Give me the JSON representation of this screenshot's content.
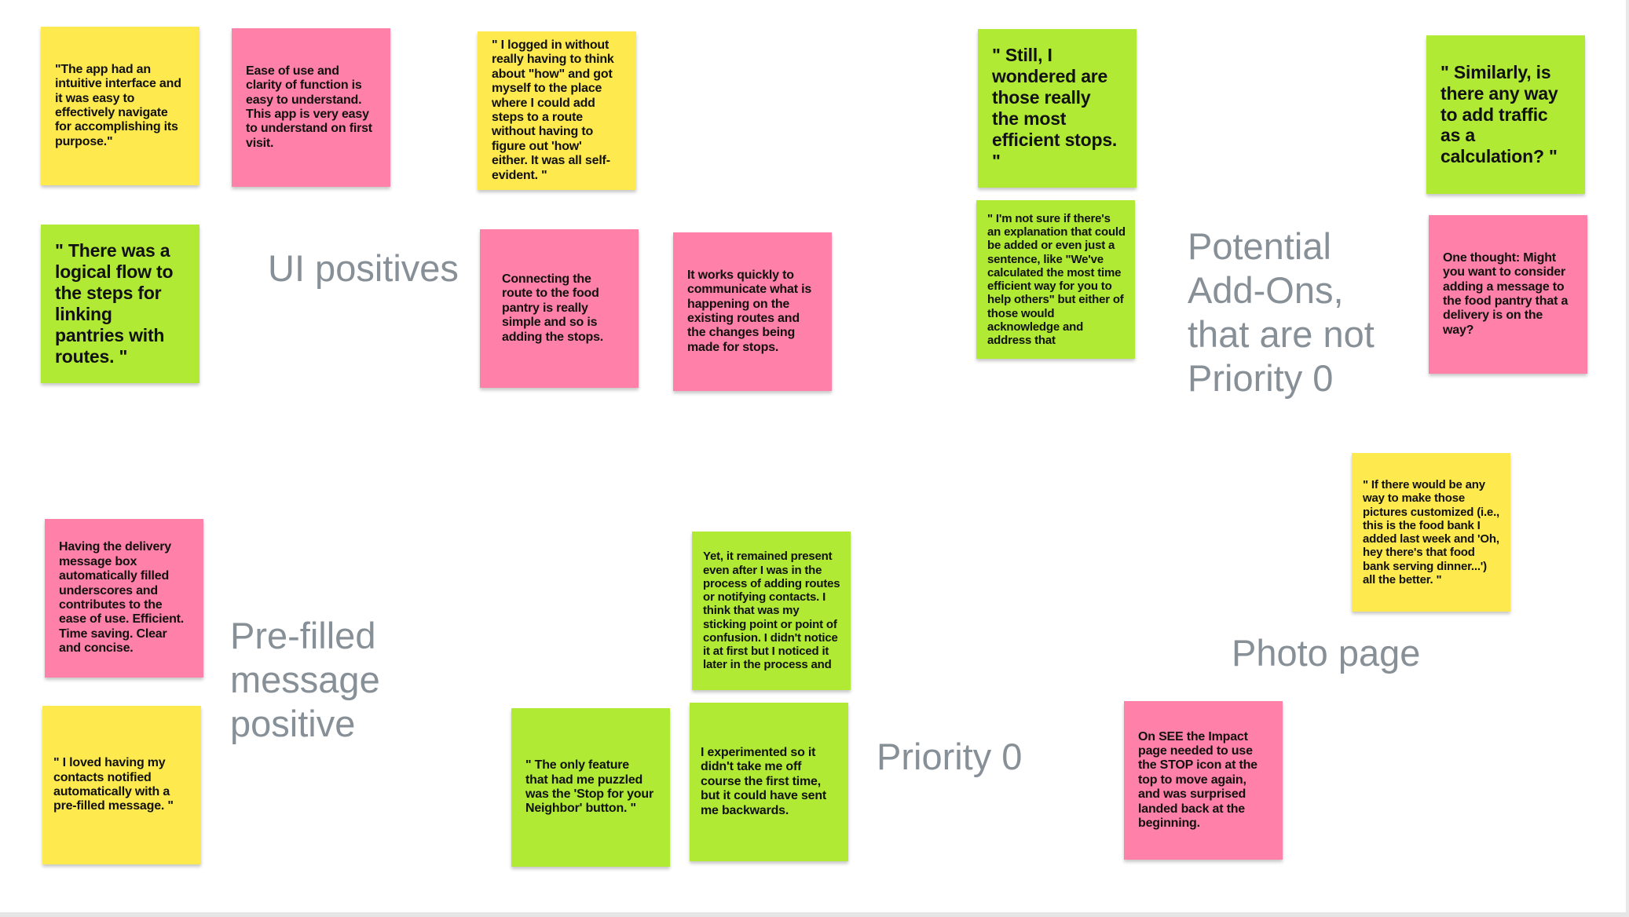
{
  "colors": {
    "yellow": "#fee94e",
    "pink": "#ff80a8",
    "green": "#b0ea35",
    "label": "#878f97"
  },
  "labels": {
    "ui_positives": "UI positives",
    "potential_addons": "Potential Add-Ons, that are not Priority 0",
    "prefilled": "Pre-filled message positive",
    "priority0": "Priority 0",
    "photo_page": "Photo page"
  },
  "notes": [
    {
      "color": "yellow",
      "text": "\"The app had an intuitive interface and it was easy to effectively navigate for accomplishing its purpose.\""
    },
    {
      "color": "pink",
      "text": "Ease of use and clarity of function is easy to understand. This app is very easy to understand on first visit."
    },
    {
      "color": "yellow",
      "text": "\" I logged in without really having to think about \"how\" and got myself to the place where I could add steps to a route without having to figure out 'how' either. It was all self-evident. \""
    },
    {
      "color": "green",
      "text": "\" There was a logical flow to the steps for linking pantries with routes. \""
    },
    {
      "color": "pink",
      "text": "Connecting the route to the food pantry is really simple and so is adding the stops."
    },
    {
      "color": "pink",
      "text": "It works quickly to communicate what is happening on the existing routes and the changes being made for stops."
    },
    {
      "color": "green",
      "text": "\" Still, I wondered are those really the most efficient stops.  \""
    },
    {
      "color": "green",
      "text": "\" I'm not sure if there's an explanation that could be added or even just a sentence, like \"We've calculated the most time efficient way for you to help others\" but either of those would acknowledge and address that"
    },
    {
      "color": "green",
      "text": "\" Similarly, is there any way to add traffic as a calculation? \""
    },
    {
      "color": "pink",
      "text": "One thought: Might you want to consider adding a message to the food pantry that a delivery is on the way?"
    },
    {
      "color": "yellow",
      "text": "\" If there would be any way to make those pictures customized (i.e., this is the food bank I added last week and 'Oh, hey there's that food bank serving dinner...') all the better. \""
    },
    {
      "color": "pink",
      "text": "Having the delivery message box automatically filled underscores and contributes to the ease of use. Efficient. Time saving. Clear and concise."
    },
    {
      "color": "yellow",
      "text": "\" I loved having my contacts notified automatically with a pre-filled message. \""
    },
    {
      "color": "green",
      "text": "Yet, it remained present even after I was in the process of adding routes or notifying contacts. I think that was my sticking point or point of confusion. I didn't notice it at first but I noticed it later in the process and"
    },
    {
      "color": "green",
      "text": "\" The only feature that had me puzzled was the 'Stop for your Neighbor' button. \""
    },
    {
      "color": "green",
      "text": "I experimented so it didn't take me off course the first time, but it could have sent me backwards."
    },
    {
      "color": "pink",
      "text": "On SEE the Impact page needed to use the STOP icon at the top to move again, and was surprised landed back at the beginning."
    }
  ]
}
